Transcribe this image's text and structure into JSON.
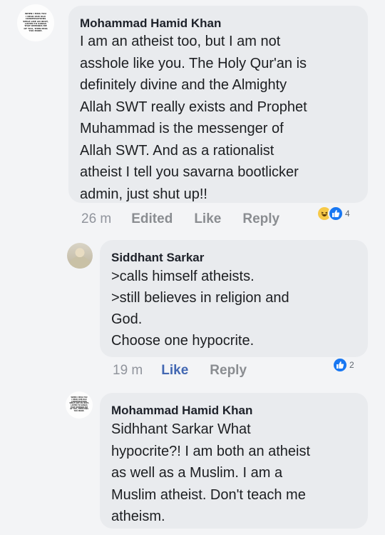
{
  "comments": [
    {
      "author": "Mohammad Hamid Khan",
      "avatar_text": [
        "WHEN I MISS YOU",
        "I READ OUR OLD",
        "CONVERSATIONS",
        "SMILE LIKE AN IDIOT,",
        "LISTEN TO SONGS",
        "THAT REMINDS ME",
        "OF YOU, THEN MISS",
        "YOU MORE."
      ],
      "text": "I am an atheist too, but I am not\nasshole like you. The Holy Qur'an is\ndefinitely divine and the Almighty\nAllah SWT really exists and Prophet\nMuhammad is the messenger of\nAllah SWT. And as a rationalist\natheist I tell you savarna bootlicker\nadmin, just shut up!!",
      "time": "26 m",
      "edited": "Edited",
      "like": "Like",
      "reply": "Reply",
      "reaction_count": "4",
      "reactions": [
        "haha-icon",
        "like-icon"
      ]
    },
    {
      "author": "Siddhant Sarkar",
      "text": ">calls himself atheists.\n>still believes in religion and\nGod.\nChoose one hypocrite.",
      "time": "19 m",
      "like": "Like",
      "reply": "Reply",
      "reaction_count": "2",
      "reactions": [
        "like-icon"
      ]
    },
    {
      "author": "Mohammad Hamid Khan",
      "avatar_text": [
        "WHEN I MISS YOU",
        "I READ OUR OLD",
        "CONVERSATIONS",
        "SMILE LIKE AN IDIOT,",
        "LISTEN TO SONGS",
        "THAT REMINDS ME",
        "OF YOU, THEN MISS",
        "YOU MORE."
      ],
      "text": "Sidhhant Sarkar What\nhypocrite?! I am both an atheist\nas well as a Muslim. I am a\nMuslim atheist. Don't teach me\natheism."
    }
  ],
  "colors": {
    "bubble": "#e9ebee",
    "like_blue": "#4267b2",
    "haha_yellow": "#f7c948",
    "reaction_blue": "#1877f2"
  }
}
